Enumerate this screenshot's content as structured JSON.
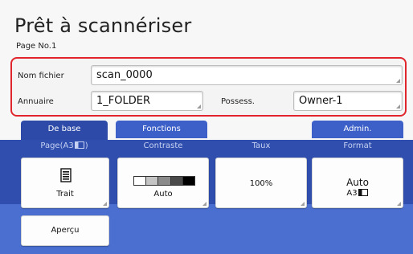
{
  "screen": {
    "title": "Prêt à scannériser",
    "page_label": "Page No.1"
  },
  "fields": {
    "filename_label": "Nom fichier",
    "filename_value": "scan_0000",
    "directory_label": "Annuaire",
    "directory_value": "1_FOLDER",
    "owner_label": "Possess.",
    "owner_value": "Owner-1"
  },
  "tabs": {
    "basic": "De base",
    "functions": "Fonctions",
    "admin": "Admin."
  },
  "columns": {
    "page": "Page(A3",
    "contrast": "Contraste",
    "rate": "Taux",
    "format": "Format"
  },
  "buttons": {
    "mode_label": "Trait",
    "contrast_label": "Auto",
    "rate_value": "100%",
    "format_line1": "Auto",
    "format_line2": "A3",
    "preview": "Aperçu"
  },
  "colors": {
    "accent_red": "#e0262c",
    "panel_blue": "#2f4eae",
    "tab_blue": "#3c5fc8"
  }
}
